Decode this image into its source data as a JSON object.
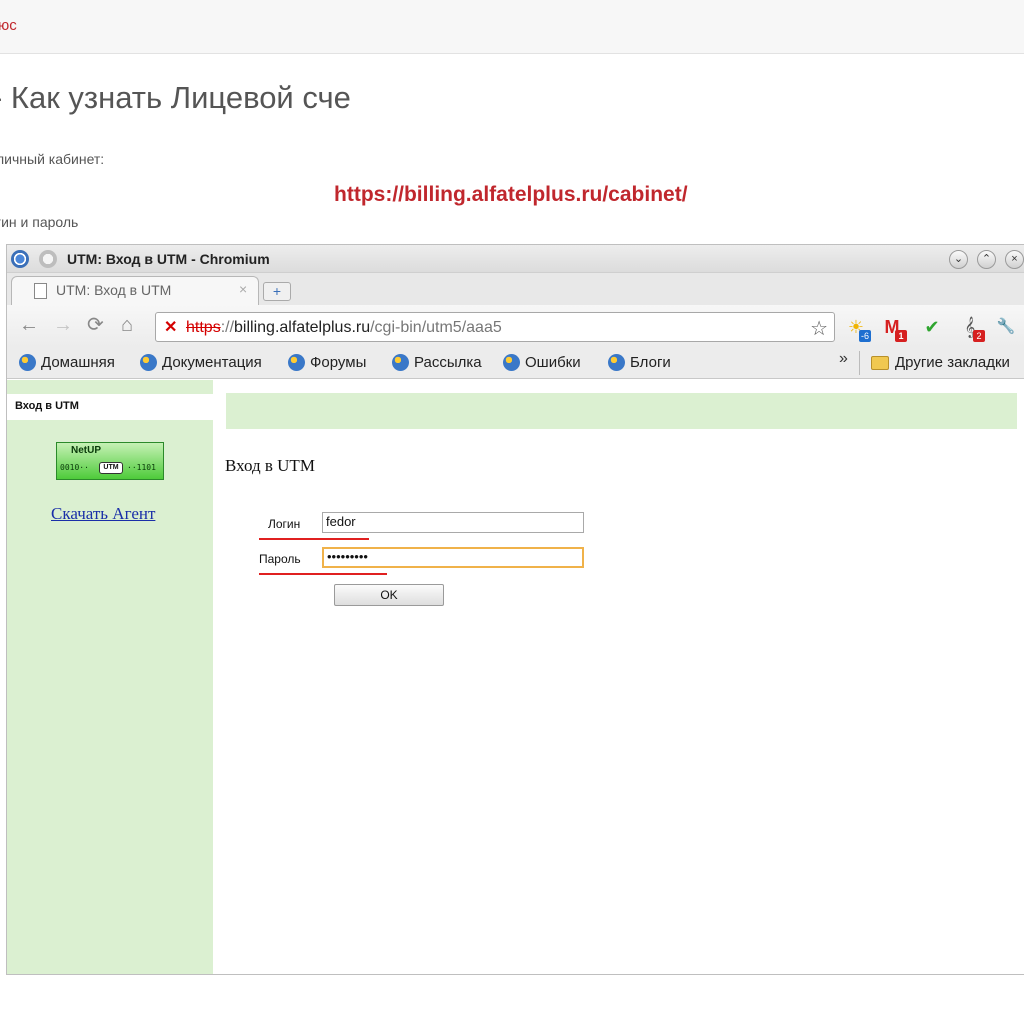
{
  "page": {
    "top_strip_text": "юс",
    "heading": "- Как узнать Лицевой сче",
    "line1": "личный кабинет:",
    "url": "https://billing.alfatelplus.ru/cabinet/",
    "line2": "гин и пароль"
  },
  "browser": {
    "window_title": "UTM: Вход в UTM - Chromium",
    "tab_label": "UTM: Вход в UTM",
    "tab_close": "×",
    "new_tab": "+",
    "address": {
      "scheme": "https",
      "separator": "://",
      "host": "billing.alfatelplus.ru",
      "path": "/cgi-bin/utm5/aaa5"
    },
    "nav": {
      "back": "←",
      "forward": "→",
      "reload": "⟳",
      "home": "⌂"
    },
    "window_controls": {
      "minimize": "⌄",
      "maximize": "⌃",
      "close": "×"
    },
    "extensions": [
      {
        "name": "weather-icon",
        "glyph": "☀",
        "badge": "-6",
        "badge_color": "#1e6fd0"
      },
      {
        "name": "gmail-icon",
        "glyph": "M",
        "badge": "1",
        "badge_color": "#d62020"
      },
      {
        "name": "check-icon",
        "glyph": "✔",
        "badge": "",
        "badge_color": ""
      },
      {
        "name": "music-icon",
        "glyph": "𝄞",
        "badge": "2",
        "badge_color": "#d62020"
      },
      {
        "name": "wrench-icon",
        "glyph": "🔧",
        "badge": "",
        "badge_color": ""
      }
    ],
    "bookmarks": [
      "Домашняя",
      "Документация",
      "Форумы",
      "Рассылка",
      "Ошибки",
      "Блоги"
    ],
    "bookmarks_more": "»",
    "other_bookmarks": "Другие закладки"
  },
  "utm": {
    "sidebar_title": "Вход в UTM",
    "logo_text": "NetUP",
    "logo_bits_left": "0010··",
    "logo_center": "UTM",
    "logo_bits_right": "··1101",
    "download_agent": "Скачать Агент",
    "form_title": "Вход в UTM",
    "login_label": "Логин",
    "login_value": "fedor",
    "password_label": "Пароль",
    "password_value": "•••••••••",
    "ok_label": "OK"
  },
  "colors": {
    "accent_red": "#c0272d",
    "utm_green": "#dbf0d1",
    "link_blue": "#1a2fa8"
  }
}
